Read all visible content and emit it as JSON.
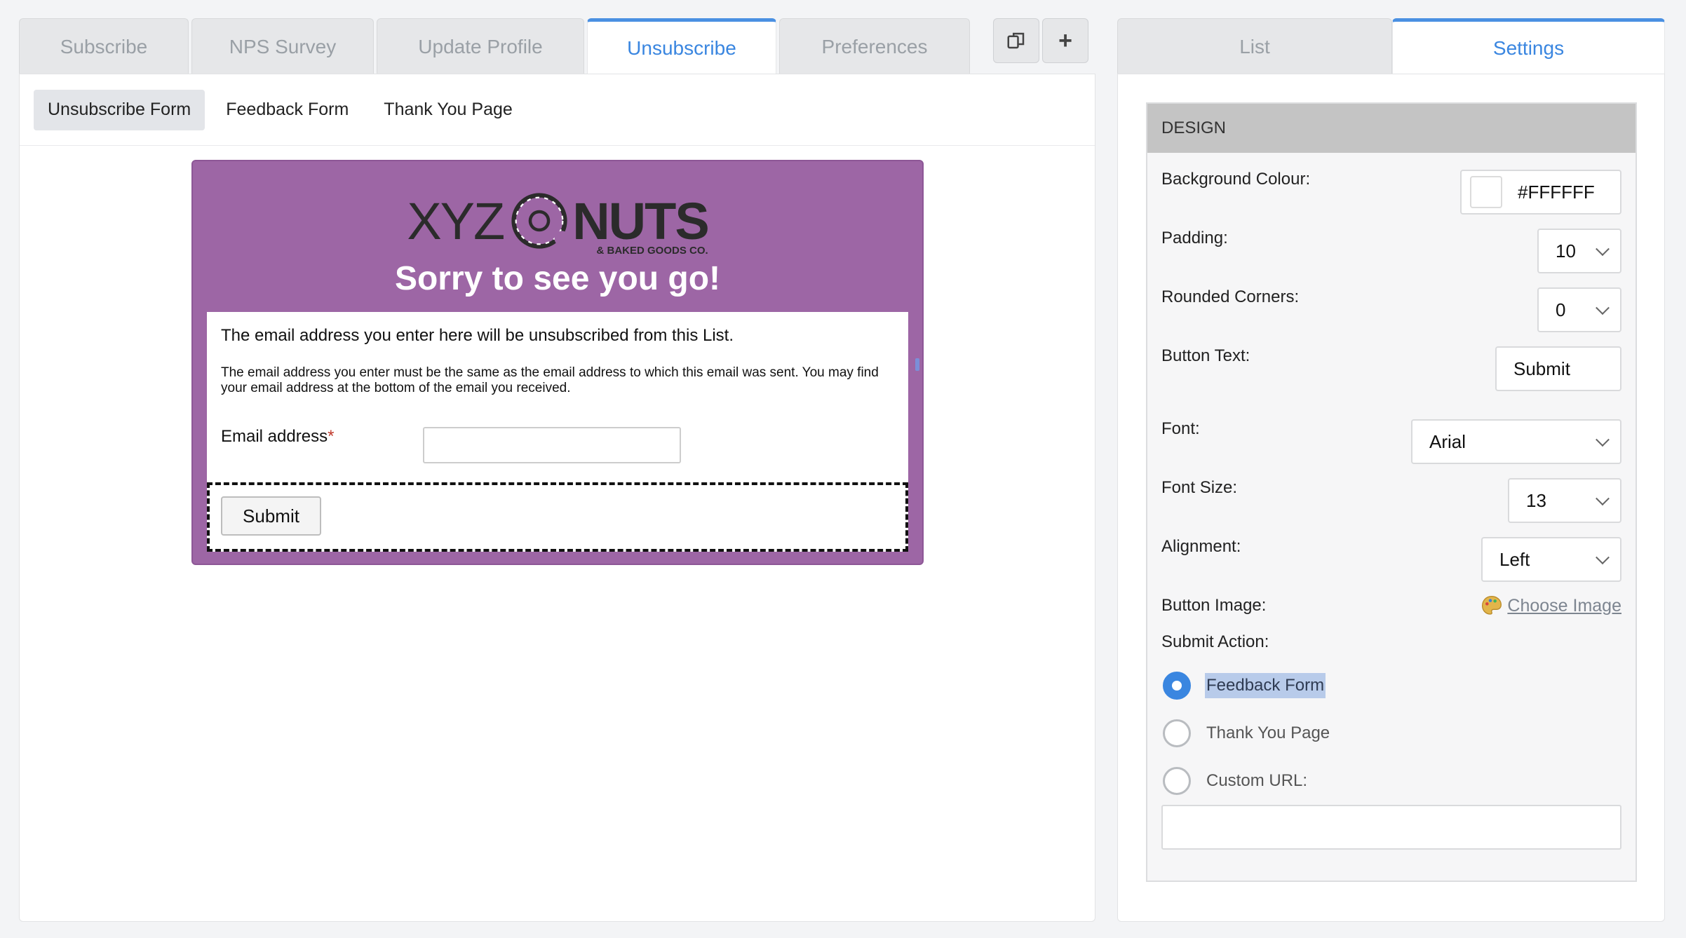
{
  "left_tabs": [
    {
      "label": "Subscribe",
      "active": false
    },
    {
      "label": "NPS Survey",
      "active": false
    },
    {
      "label": "Update Profile",
      "active": false
    },
    {
      "label": "Unsubscribe",
      "active": true
    },
    {
      "label": "Preferences",
      "active": false
    }
  ],
  "toolbar": {
    "copy_icon": "copy-icon",
    "add_icon": "plus-icon",
    "add_glyph": "+"
  },
  "subtabs": [
    {
      "label": "Unsubscribe Form",
      "active": true
    },
    {
      "label": "Feedback Form",
      "active": false
    },
    {
      "label": "Thank You Page",
      "active": false
    }
  ],
  "form": {
    "logo_left": "XYZ",
    "logo_right": "NUTS",
    "logo_sub": "& BAKED GOODS CO.",
    "heading": "Sorry to see you go!",
    "intro": "The email address you enter here will be unsubscribed from this List.",
    "note": "The email address you enter must be the same as the email address to which this email was sent. You may find your email address at the bottom of the email you received.",
    "email_label": "Email address",
    "required_mark": "*",
    "email_value": "",
    "submit_label": "Submit",
    "brand_color": "#9D66A5"
  },
  "right_tabs": [
    {
      "label": "List",
      "active": false
    },
    {
      "label": "Settings",
      "active": true
    }
  ],
  "design": {
    "header": "DESIGN",
    "background_colour": {
      "label": "Background Colour:",
      "value": "#FFFFFF"
    },
    "padding": {
      "label": "Padding:",
      "value": "10"
    },
    "rounded_corners": {
      "label": "Rounded Corners:",
      "value": "0"
    },
    "button_text": {
      "label": "Button Text:",
      "value": "Submit"
    },
    "font": {
      "label": "Font:",
      "value": "Arial"
    },
    "font_size": {
      "label": "Font Size:",
      "value": "13"
    },
    "alignment": {
      "label": "Alignment:",
      "value": "Left"
    },
    "button_image": {
      "label": "Button Image:",
      "link": "Choose Image"
    },
    "submit_action": {
      "label": "Submit Action:",
      "options": [
        {
          "label": "Feedback Form",
          "selected": true
        },
        {
          "label": "Thank You Page",
          "selected": false
        },
        {
          "label": "Custom URL:",
          "selected": false
        }
      ],
      "custom_url": ""
    }
  },
  "colors": {
    "accent": "#4A90E2",
    "tab_inactive": "#E6E7E9",
    "design_header": "#C4C4C4"
  }
}
